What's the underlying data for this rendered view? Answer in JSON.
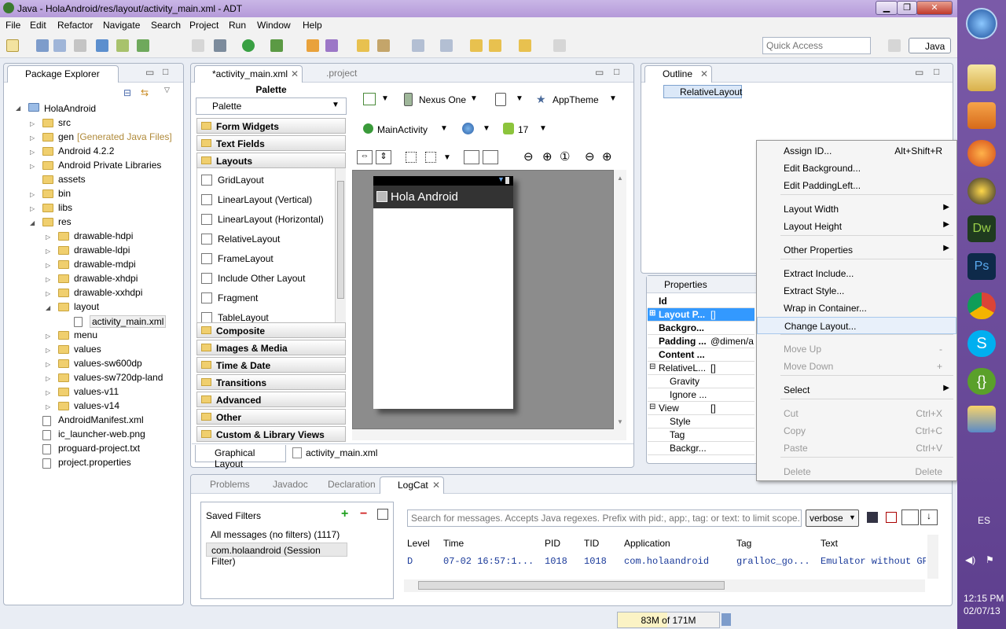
{
  "window": {
    "title": "Java - HolaAndroid/res/layout/activity_main.xml - ADT",
    "min": "▁",
    "max": "❐",
    "close": "✕"
  },
  "menubar": [
    "File",
    "Edit",
    "Refactor",
    "Navigate",
    "Search",
    "Project",
    "Run",
    "Window",
    "Help"
  ],
  "quick_access": {
    "placeholder": "Quick Access"
  },
  "perspective": "Java",
  "package_explorer": {
    "title": "Package Explorer",
    "project": "HolaAndroid",
    "items": [
      "src",
      "gen",
      "Android 4.2.2",
      "Android Private Libraries",
      "assets",
      "bin",
      "libs",
      "res",
      "drawable-hdpi",
      "drawable-ldpi",
      "drawable-mdpi",
      "drawable-xhdpi",
      "drawable-xxhdpi",
      "layout",
      "activity_main.xml",
      "menu",
      "values",
      "values-sw600dp",
      "values-sw720dp-land",
      "values-v11",
      "values-v14",
      "AndroidManifest.xml",
      "ic_launcher-web.png",
      "proguard-project.txt",
      "project.properties"
    ],
    "gen_note": "[Generated Java Files]"
  },
  "editor": {
    "tab_active": "*activity_main.xml",
    "tab_other": ".project",
    "palette_header": "Palette",
    "palette_select": "Palette",
    "categories_top": [
      "Form Widgets",
      "Text Fields",
      "Layouts"
    ],
    "layouts": [
      "GridLayout",
      "LinearLayout (Vertical)",
      "LinearLayout (Horizontal)",
      "RelativeLayout",
      "FrameLayout",
      "Include Other Layout",
      "Fragment",
      "TableLayout"
    ],
    "categories_bottom": [
      "Composite",
      "Images & Media",
      "Time & Date",
      "Transitions",
      "Advanced",
      "Other",
      "Custom & Library Views"
    ],
    "device": "Nexus One",
    "theme": "AppTheme",
    "activity": "MainActivity",
    "api": "17",
    "app_title": "Hola Android",
    "bottom_tabs": [
      "Graphical Layout",
      "activity_main.xml"
    ]
  },
  "outline": {
    "title": "Outline",
    "node": "RelativeLayout"
  },
  "properties": {
    "title": "Properties",
    "rows": [
      {
        "n": "Id",
        "v": ""
      },
      {
        "n": "Layout P...",
        "v": "[]"
      },
      {
        "n": "Backgro...",
        "v": ""
      },
      {
        "n": "Padding ...",
        "v": "@dimen/a"
      },
      {
        "n": "Content ...",
        "v": ""
      },
      {
        "n": "RelativeL...",
        "v": "[]"
      },
      {
        "n": "Gravity",
        "v": ""
      },
      {
        "n": "Ignore ...",
        "v": ""
      },
      {
        "n": "View",
        "v": "[]"
      },
      {
        "n": "Style",
        "v": ""
      },
      {
        "n": "Tag",
        "v": ""
      },
      {
        "n": "Backgr...",
        "v": ""
      }
    ]
  },
  "context_menu": [
    {
      "label": "Assign ID...",
      "key": "Alt+Shift+R"
    },
    {
      "label": "Edit Background...",
      "key": ""
    },
    {
      "label": "Edit PaddingLeft...",
      "key": ""
    },
    {
      "label": "Layout Width",
      "key": ""
    },
    {
      "label": "Layout Height",
      "key": ""
    },
    {
      "label": "Other Properties",
      "key": ""
    },
    {
      "label": "Extract Include...",
      "key": ""
    },
    {
      "label": "Extract Style...",
      "key": ""
    },
    {
      "label": "Wrap in Container...",
      "key": ""
    },
    {
      "label": "Change Layout...",
      "key": ""
    },
    {
      "label": "Move Up",
      "key": "-"
    },
    {
      "label": "Move Down",
      "key": "+"
    },
    {
      "label": "Select",
      "key": ""
    },
    {
      "label": "Cut",
      "key": "Ctrl+X"
    },
    {
      "label": "Copy",
      "key": "Ctrl+C"
    },
    {
      "label": "Paste",
      "key": "Ctrl+V"
    },
    {
      "label": "Delete",
      "key": "Delete"
    }
  ],
  "bottom": {
    "tabs": [
      "Problems",
      "Javadoc",
      "Declaration",
      "LogCat"
    ],
    "saved_filters": "Saved Filters",
    "filter1": "All messages (no filters) (1117)",
    "filter2": "com.holaandroid (Session Filter)",
    "search_placeholder": "Search for messages. Accepts Java regexes. Prefix with pid:, app:, tag: or text: to limit scope.",
    "level_select": "verbose",
    "columns": [
      "Level",
      "Time",
      "PID",
      "TID",
      "Application",
      "Tag",
      "Text"
    ],
    "row": [
      "D",
      "07-02 16:57:1...",
      "1018",
      "1018",
      "com.holaandroid",
      "gralloc_go...",
      "Emulator without GP"
    ]
  },
  "heap": "83M of 171M",
  "taskbar": {
    "lang": "ES",
    "time": "12:15 PM",
    "date": "02/07/13"
  }
}
